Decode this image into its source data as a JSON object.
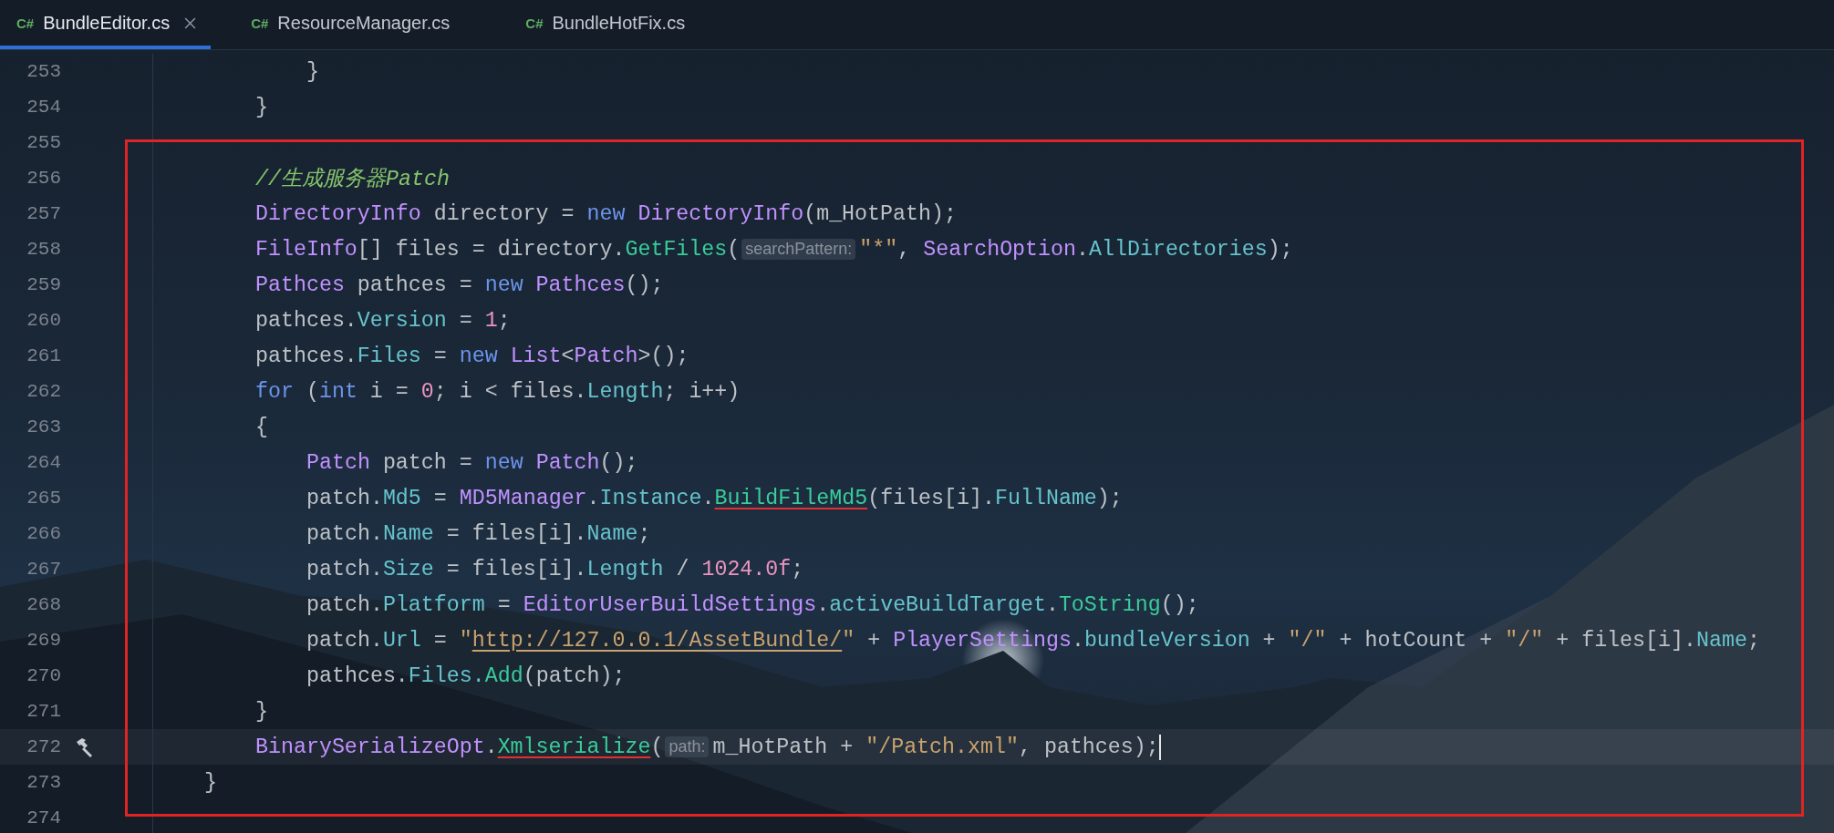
{
  "tabs": [
    {
      "lang": "C#",
      "label": "BundleEditor.cs",
      "selected": true
    },
    {
      "lang": "C#",
      "label": "ResourceManager.cs",
      "selected": false
    },
    {
      "lang": "C#",
      "label": "BundleHotFix.cs",
      "selected": false
    }
  ],
  "lines": [
    {
      "children": [
        {
          "children": [
            {
              "children": [
                {
                  "number": "253",
                  "current": false,
                  "has_hammer": false,
                  "tokens": [
                    {
                      "kind": "plain",
                      "text": "}"
                    }
                  ]
                }
              ]
            },
            {
              "number": "254",
              "current": false,
              "has_hammer": false,
              "tokens": [
                {
                  "kind": "plain",
                  "text": "}"
                }
              ]
            },
            {
              "number": "255",
              "current": false,
              "has_hammer": false
            },
            {
              "number": "256",
              "current": false,
              "has_hammer": false,
              "tokens": [
                {
                  "kind": "comment",
                  "text": "//生成服务器Patch"
                }
              ]
            },
            {
              "number": "257",
              "current": false,
              "has_hammer": false,
              "tokens": [
                {
                  "kind": "type",
                  "text": "DirectoryInfo"
                },
                {
                  "kind": "plain",
                  "text": " directory = "
                },
                {
                  "kind": "keyword",
                  "text": "new "
                },
                {
                  "kind": "type",
                  "text": "DirectoryInfo"
                },
                {
                  "kind": "plain",
                  "text": "(m_HotPath);"
                }
              ]
            },
            {
              "number": "258",
              "current": false,
              "has_hammer": false,
              "tokens": [
                {
                  "kind": "type",
                  "text": "FileInfo"
                },
                {
                  "kind": "plain",
                  "text": "[] files = directory."
                },
                {
                  "kind": "method",
                  "text": "GetFiles"
                },
                {
                  "kind": "plain",
                  "text": "("
                },
                {
                  "kind": "hint",
                  "text": "searchPattern:"
                },
                {
                  "kind": "string",
                  "text": "\"*\""
                },
                {
                  "kind": "plain",
                  "text": ", "
                },
                {
                  "kind": "type",
                  "text": "SearchOption"
                },
                {
                  "kind": "plain",
                  "text": "."
                },
                {
                  "kind": "field",
                  "text": "AllDirectories"
                },
                {
                  "kind": "plain",
                  "text": ");"
                }
              ]
            },
            {
              "number": "259",
              "current": false,
              "has_hammer": false,
              "tokens": [
                {
                  "kind": "type",
                  "text": "Pathces"
                },
                {
                  "kind": "plain",
                  "text": " pathces = "
                },
                {
                  "kind": "keyword",
                  "text": "new "
                },
                {
                  "kind": "type",
                  "text": "Pathces"
                },
                {
                  "kind": "plain",
                  "text": "();"
                }
              ]
            },
            {
              "number": "260",
              "current": false,
              "has_hammer": false,
              "tokens": [
                {
                  "kind": "plain",
                  "text": "pathces."
                },
                {
                  "kind": "field",
                  "text": "Version"
                },
                {
                  "kind": "plain",
                  "text": " = "
                },
                {
                  "kind": "number",
                  "text": "1"
                },
                {
                  "kind": "plain",
                  "text": ";"
                }
              ]
            },
            {
              "number": "261",
              "current": false,
              "has_hammer": false,
              "tokens": [
                {
                  "kind": "plain",
                  "text": "pathces."
                },
                {
                  "kind": "field",
                  "text": "Files"
                },
                {
                  "kind": "plain",
                  "text": " = "
                },
                {
                  "kind": "keyword",
                  "text": "new "
                },
                {
                  "kind": "type",
                  "text": "List"
                },
                {
                  "kind": "plain",
                  "text": "<"
                },
                {
                  "kind": "type",
                  "text": "Patch"
                },
                {
                  "kind": "plain",
                  "text": ">();"
                }
              ]
            },
            {
              "number": "262",
              "current": false,
              "has_hammer": false,
              "tokens": [
                {
                  "kind": "keyword",
                  "text": "for"
                },
                {
                  "kind": "plain",
                  "text": " ("
                },
                {
                  "kind": "keyword",
                  "text": "int"
                },
                {
                  "kind": "plain",
                  "text": " i = "
                },
                {
                  "kind": "number",
                  "text": "0"
                },
                {
                  "kind": "plain",
                  "text": "; i < files."
                },
                {
                  "kind": "field",
                  "text": "Length"
                },
                {
                  "kind": "plain",
                  "text": "; i++)"
                }
              ]
            },
            {
              "number": "263",
              "current": false,
              "has_hammer": false,
              "tokens": [
                {
                  "kind": "plain",
                  "text": "{"
                }
              ],
              "children": [
                {
                  "number": "264",
                  "current": false,
                  "has_hammer": false,
                  "tokens": [
                    {
                      "kind": "type",
                      "text": "Patch"
                    },
                    {
                      "kind": "plain",
                      "text": " patch = "
                    },
                    {
                      "kind": "keyword",
                      "text": "new "
                    },
                    {
                      "kind": "type",
                      "text": "Patch"
                    },
                    {
                      "kind": "plain",
                      "text": "();"
                    }
                  ]
                },
                {
                  "number": "265",
                  "current": false,
                  "has_hammer": false,
                  "tokens": [
                    {
                      "kind": "plain",
                      "text": "patch."
                    },
                    {
                      "kind": "field",
                      "text": "Md5"
                    },
                    {
                      "kind": "plain",
                      "text": " = "
                    },
                    {
                      "kind": "type",
                      "text": "MD5Manager"
                    },
                    {
                      "kind": "plain",
                      "text": "."
                    },
                    {
                      "kind": "field",
                      "text": "Instance"
                    },
                    {
                      "kind": "plain",
                      "text": "."
                    },
                    {
                      "kind": "error",
                      "text": "BuildFileMd5"
                    },
                    {
                      "kind": "plain",
                      "text": "(files[i]."
                    },
                    {
                      "kind": "field",
                      "text": "FullName"
                    },
                    {
                      "kind": "plain",
                      "text": ");"
                    }
                  ]
                },
                {
                  "number": "266",
                  "current": false,
                  "has_hammer": false,
                  "tokens": [
                    {
                      "kind": "plain",
                      "text": "patch."
                    },
                    {
                      "kind": "field",
                      "text": "Name"
                    },
                    {
                      "kind": "plain",
                      "text": " = files[i]."
                    },
                    {
                      "kind": "field",
                      "text": "Name"
                    },
                    {
                      "kind": "plain",
                      "text": ";"
                    }
                  ]
                },
                {
                  "number": "267",
                  "current": false,
                  "has_hammer": false,
                  "tokens": [
                    {
                      "kind": "plain",
                      "text": "patch."
                    },
                    {
                      "kind": "field",
                      "text": "Size"
                    },
                    {
                      "kind": "plain",
                      "text": " = files[i]."
                    },
                    {
                      "kind": "field",
                      "text": "Length"
                    },
                    {
                      "kind": "plain",
                      "text": " / "
                    },
                    {
                      "kind": "number",
                      "text": "1024.0f"
                    },
                    {
                      "kind": "plain",
                      "text": ";"
                    }
                  ]
                },
                {
                  "number": "268",
                  "current": false,
                  "has_hammer": false,
                  "tokens": [
                    {
                      "kind": "plain",
                      "text": "patch."
                    },
                    {
                      "kind": "field",
                      "text": "Platform"
                    },
                    {
                      "kind": "plain",
                      "text": " = "
                    },
                    {
                      "kind": "type",
                      "text": "EditorUserBuildSettings"
                    },
                    {
                      "kind": "plain",
                      "text": "."
                    },
                    {
                      "kind": "field",
                      "text": "activeBuildTarget"
                    },
                    {
                      "kind": "plain",
                      "text": "."
                    },
                    {
                      "kind": "method",
                      "text": "ToString"
                    },
                    {
                      "kind": "plain",
                      "text": "();"
                    }
                  ]
                },
                {
                  "number": "269",
                  "current": false,
                  "has_hammer": false,
                  "tokens": [
                    {
                      "kind": "plain",
                      "text": "patch."
                    },
                    {
                      "kind": "field",
                      "text": "Url"
                    },
                    {
                      "kind": "plain",
                      "text": " = "
                    },
                    {
                      "kind": "string",
                      "text": "\""
                    },
                    {
                      "kind": "link",
                      "text": "http://127.0.0.1/AssetBundle/"
                    },
                    {
                      "kind": "string",
                      "text": "\""
                    },
                    {
                      "kind": "plain",
                      "text": " + "
                    },
                    {
                      "kind": "type",
                      "text": "PlayerSettings"
                    },
                    {
                      "kind": "plain",
                      "text": "."
                    },
                    {
                      "kind": "field",
                      "text": "bundleVersion"
                    },
                    {
                      "kind": "plain",
                      "text": " + "
                    },
                    {
                      "kind": "string",
                      "text": "\"/\""
                    },
                    {
                      "kind": "plain",
                      "text": " + hotCount + "
                    },
                    {
                      "kind": "string",
                      "text": "\"/\""
                    },
                    {
                      "kind": "plain",
                      "text": " + files[i]."
                    },
                    {
                      "kind": "field",
                      "text": "Name"
                    },
                    {
                      "kind": "plain",
                      "text": ";"
                    }
                  ]
                },
                {
                  "number": "270",
                  "current": false,
                  "has_hammer": false,
                  "tokens": [
                    {
                      "kind": "plain",
                      "text": "pathces."
                    },
                    {
                      "kind": "field",
                      "text": "Files."
                    },
                    {
                      "kind": "method",
                      "text": "Add"
                    },
                    {
                      "kind": "plain",
                      "text": "(patch);"
                    }
                  ]
                }
              ]
            },
            {
              "number": "271",
              "current": false,
              "has_hammer": false,
              "tokens": [
                {
                  "kind": "plain",
                  "text": "}"
                }
              ]
            },
            {
              "number": "272",
              "current": true,
              "has_hammer": true,
              "tokens": [
                {
                  "kind": "type",
                  "text": "BinarySerializeOpt"
                },
                {
                  "kind": "plain",
                  "text": "."
                },
                {
                  "kind": "error",
                  "text": "Xmlserialize"
                },
                {
                  "kind": "plain",
                  "text": "("
                },
                {
                  "kind": "hint",
                  "text": "path:"
                },
                {
                  "kind": "plain",
                  "text": "m_HotPath + "
                },
                {
                  "kind": "string",
                  "text": "\"/Patch.xml\""
                },
                {
                  "kind": "plain",
                  "text": ", pathces);"
                }
              ]
            }
          ]
        },
        {
          "number": "273",
          "current": false,
          "has_hammer": false,
          "tokens": [
            {
              "kind": "plain",
              "text": "}"
            }
          ]
        },
        {
          "number": "274",
          "current": false,
          "has_hammer": false
        }
      ]
    }
  ]
}
